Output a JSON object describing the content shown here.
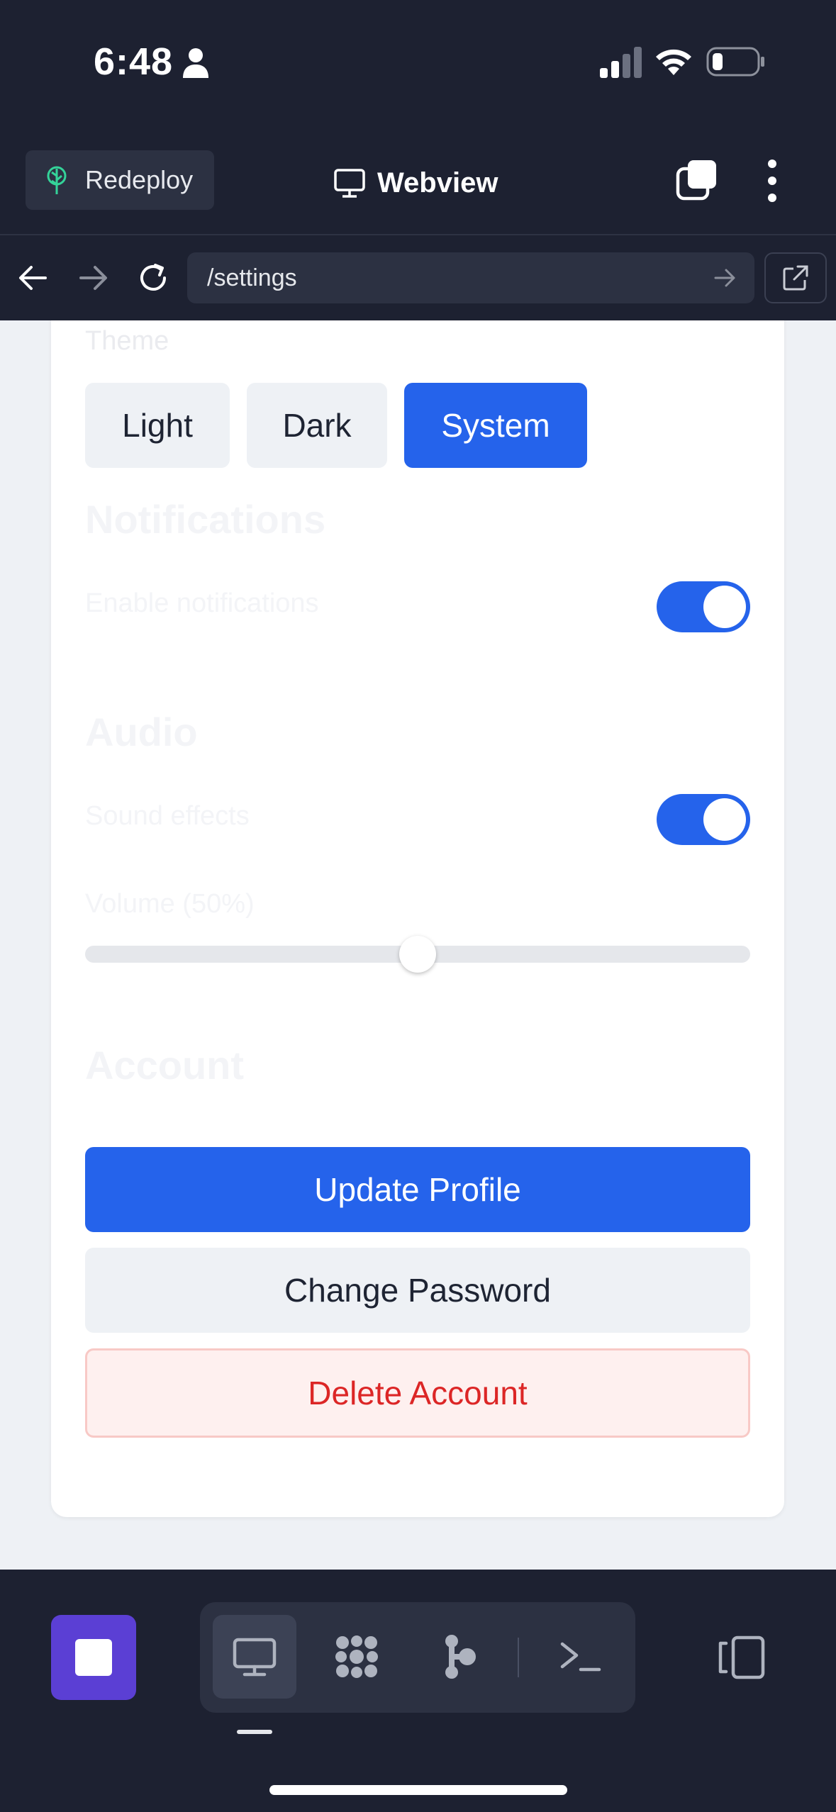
{
  "status_bar": {
    "time": "6:48"
  },
  "header": {
    "redeploy_label": "Redeploy",
    "title": "Webview"
  },
  "url_bar": {
    "url": "/settings"
  },
  "settings": {
    "theme_label": "Theme",
    "theme_options": [
      "Light",
      "Dark",
      "System"
    ],
    "selected_theme": "System",
    "notifications_title": "Notifications",
    "enable_notifications_label": "Enable notifications",
    "enable_notifications": true,
    "audio_title": "Audio",
    "sound_effects_label": "Sound effects",
    "sound_effects": true,
    "volume_label": "Volume (50%)",
    "volume_value": 0.5,
    "account_title": "Account",
    "update_profile_label": "Update Profile",
    "change_password_label": "Change Password",
    "delete_account_label": "Delete Account"
  },
  "colors": {
    "accent": "#2563eb",
    "danger": "#dc2626",
    "app_background": "#1d2131",
    "stop_button": "#5b3fd4"
  },
  "bottom_bar": {
    "dock_items": [
      "monitor-icon",
      "grid-dots-icon",
      "branch-icon",
      "terminal-icon"
    ],
    "active_dock_item": "monitor-icon"
  }
}
